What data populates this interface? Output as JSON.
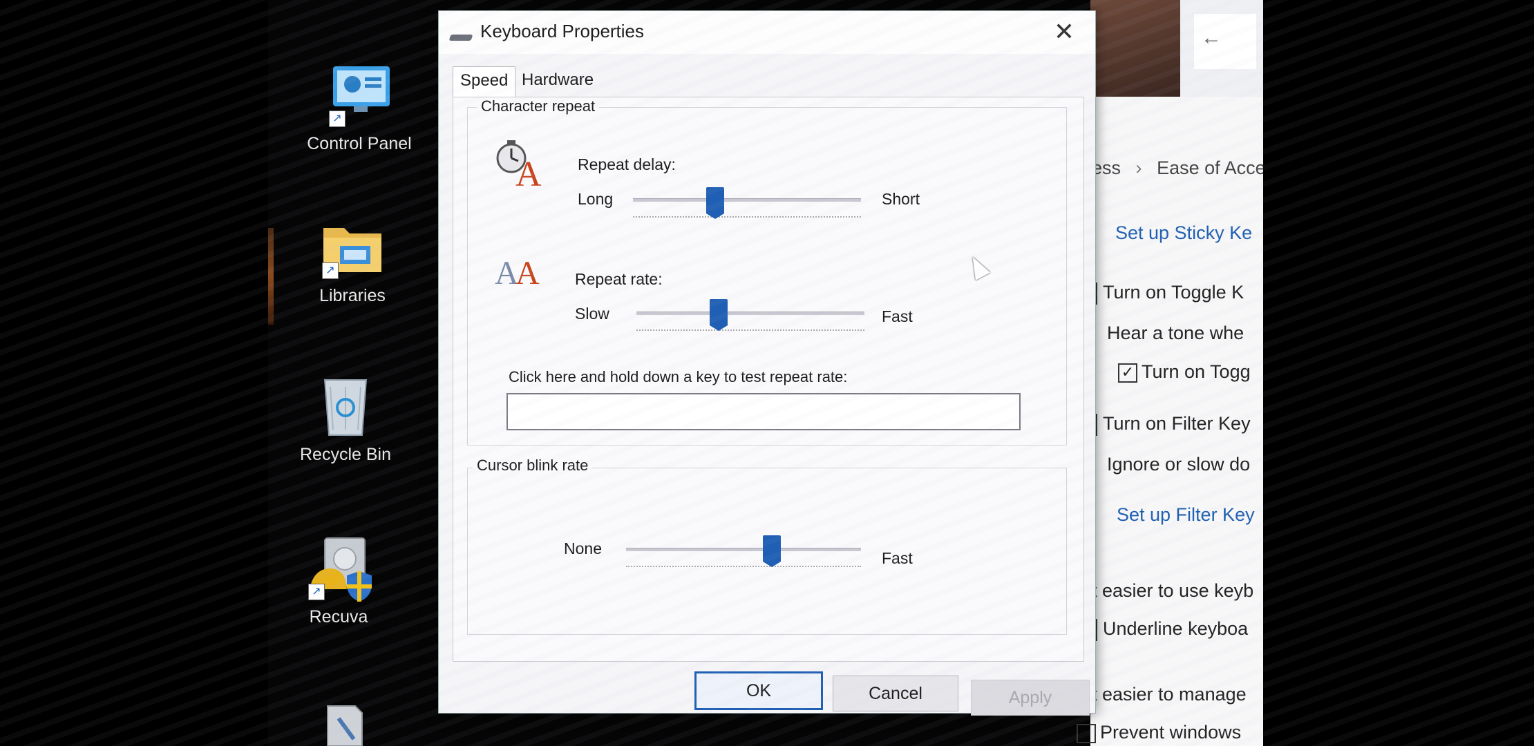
{
  "desktop": {
    "icons": [
      {
        "label": "Control Panel"
      },
      {
        "label": "Libraries"
      },
      {
        "label": "Recycle Bin"
      },
      {
        "label": "Recuva"
      }
    ]
  },
  "dialog": {
    "title": "Keyboard Properties",
    "close_glyph": "✕",
    "tabs": [
      {
        "label": "Speed",
        "active": true
      },
      {
        "label": "Hardware",
        "active": false
      }
    ],
    "character_repeat": {
      "group_label": "Character repeat",
      "repeat_delay": {
        "label": "Repeat delay:",
        "min_label": "Long",
        "max_label": "Short",
        "level": 0.35
      },
      "repeat_rate": {
        "label": "Repeat rate:",
        "min_label": "Slow",
        "max_label": "Fast",
        "level": 0.35
      },
      "test_label": "Click here and hold down a key to test repeat rate:",
      "test_value": ""
    },
    "cursor_blink": {
      "group_label": "Cursor blink rate",
      "min_label": "None",
      "max_label": "Fast",
      "level": 0.63
    },
    "buttons": {
      "ok": "OK",
      "cancel": "Cancel",
      "apply": "Apply"
    }
  },
  "settings_window": {
    "back_glyph": "←",
    "breadcrumb_left": "ess",
    "breadcrumb_sep": "›",
    "breadcrumb_right": "Ease of Acce",
    "rows": {
      "sticky_link": "Set up Sticky Ke",
      "toggle_keys": "Turn on Toggle K",
      "hear_tone": "Hear a tone whe",
      "toggle_sub": "Turn on Togg",
      "filter_keys": "Turn on Filter Key",
      "ignore_slow": "Ignore or slow do",
      "filter_link": "Set up Filter Key",
      "easier_keyboard": "t easier to use keyb",
      "underline": "Underline keyboa",
      "easier_manage": "t easier to manage",
      "prevent": "Prevent windows"
    },
    "toggle_sub_checked": true
  },
  "colors": {
    "accent": "#1f5fb4",
    "link": "#1f5fb0"
  }
}
